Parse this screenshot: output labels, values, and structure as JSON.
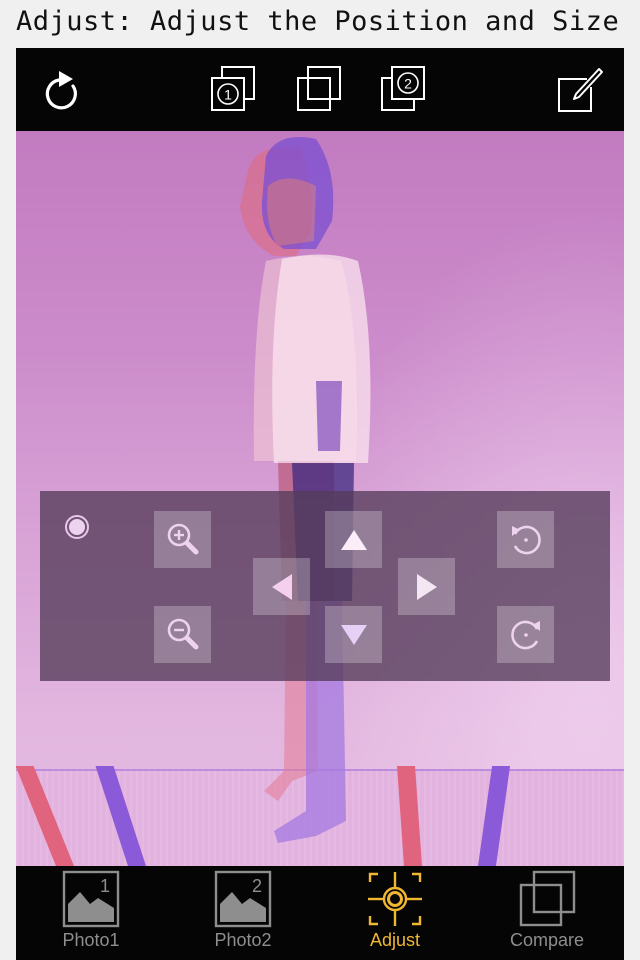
{
  "caption": "Adjust: Adjust the Position and Size",
  "toolbar": {
    "buttons": [
      {
        "name": "redo",
        "icon": "redo-icon"
      },
      {
        "name": "photo1-front",
        "icon": "layer-photo1-icon",
        "badge": "1"
      },
      {
        "name": "overlay",
        "icon": "overlay-icon"
      },
      {
        "name": "photo2-front",
        "icon": "layer-photo2-icon",
        "badge": "2"
      },
      {
        "name": "edit",
        "icon": "edit-icon"
      }
    ]
  },
  "controls": {
    "selector": "radio-selected",
    "buttons": [
      "zoom-in",
      "zoom-out",
      "move-up",
      "move-left",
      "move-right",
      "move-down",
      "rotate-left",
      "rotate-right"
    ]
  },
  "tabs": [
    {
      "label": "Photo1",
      "badge": "1",
      "active": false
    },
    {
      "label": "Photo2",
      "badge": "2",
      "active": false
    },
    {
      "label": "Adjust",
      "active": true
    },
    {
      "label": "Compare",
      "active": false
    }
  ],
  "colors": {
    "accent": "#f0b733",
    "inactive": "#8e8e8e",
    "bar": "#050505",
    "tint": "#c27bc0"
  }
}
